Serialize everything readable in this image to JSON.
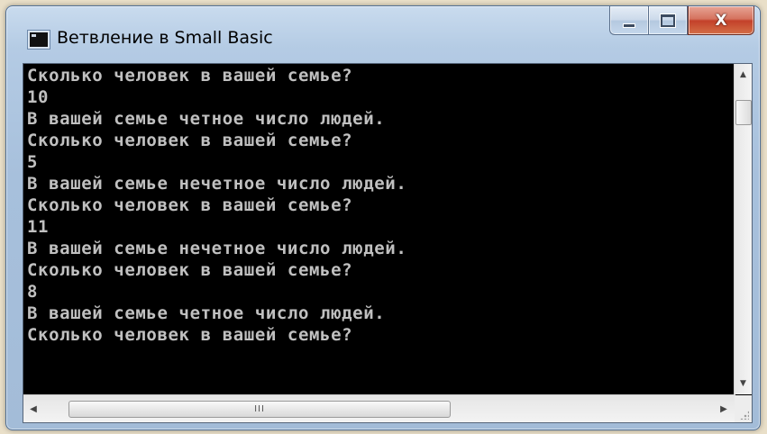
{
  "window": {
    "title": "Ветвление в Small Basic",
    "icon": "console-window-icon",
    "buttons": {
      "minimize_icon": "minimize-icon",
      "maximize_icon": "maximize-icon",
      "close_glyph": "X"
    }
  },
  "console": {
    "text_color": "#c0c0c0",
    "background": "#000000",
    "lines": [
      "Сколько человек в вашей семье?",
      "10",
      "В вашей семье четное число людей.",
      "Сколько человек в вашей семье?",
      "5",
      "В вашей семье нечетное число людей.",
      "Сколько человек в вашей семье?",
      "11",
      "В вашей семье нечетное число людей.",
      "Сколько человек в вашей семье?",
      "8",
      "В вашей семье четное число людей.",
      "Сколько человек в вашей семье?"
    ]
  },
  "scrollbars": {
    "up_arrow": "▲",
    "down_arrow": "▼",
    "left_arrow": "◀",
    "right_arrow": "▶",
    "grip": "III"
  }
}
